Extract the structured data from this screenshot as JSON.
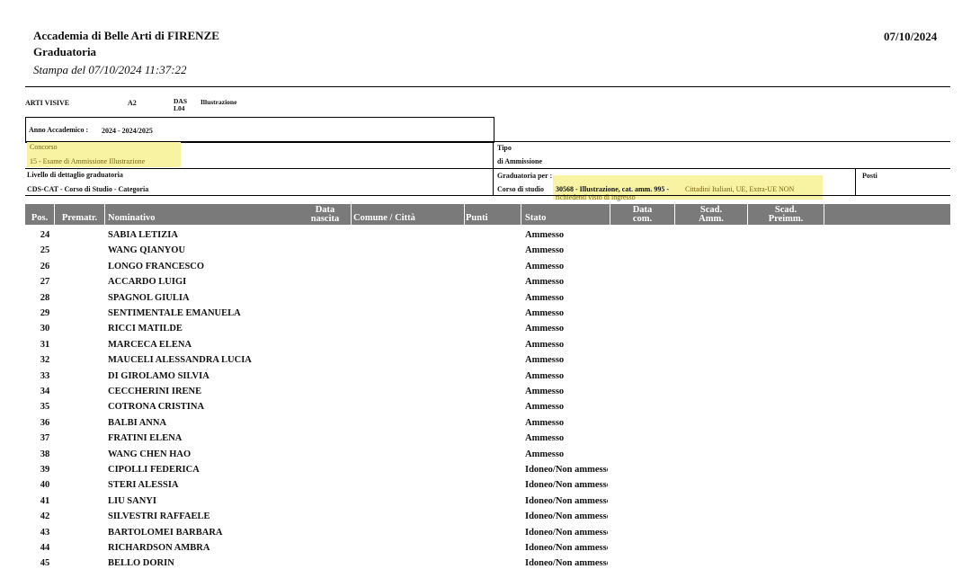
{
  "header": {
    "institution": "Accademia di Belle Arti di FIRENZE",
    "title": "Graduatoria",
    "printed": "Stampa del 07/10/2024 11:37:22",
    "date": "07/10/2024"
  },
  "course_line": {
    "area": "ARTI VISIVE",
    "level": "A2",
    "code_top": "DAS",
    "code_bottom": "L04",
    "name": "Illustrazione"
  },
  "info": {
    "anno_label": "Anno Accademico :",
    "anno_value": "2024  -  2024/2025",
    "concorso_label": "Concorso",
    "concorso_value": "15  -  Esame di Ammissione Illustrazione",
    "tipo_label": "Tipo",
    "tipo_value": "di Ammissione",
    "livello_label": "Livello di dettaglio graduatoria",
    "livello_value": "CDS-CAT  -  Corso di Studio - Categoria",
    "graduatoria_label": "Graduatoria per :",
    "corso_label": "Corso di studio",
    "corso_value": "30568 - Illustrazione, cat. amm. 995 -",
    "corso_category": "Cittadini Italiani, UE, Extra-UE NON",
    "corso_category2": "richiedenti visto di ingresso",
    "posti_label": "Posti"
  },
  "table": {
    "columns": {
      "pos": "Pos.",
      "premat": "Prematr.",
      "nominativo": "Nominativo",
      "data_nascita_1": "Data",
      "data_nascita_2": "nascita",
      "comune": "Comune / Città",
      "punti": "Punti",
      "stato": "Stato",
      "data_com_1": "Data",
      "data_com_2": "com.",
      "scad_amm_1": "Scad.",
      "scad_amm_2": "Amm.",
      "scad_preimm_1": "Scad.",
      "scad_preimm_2": "Preimm."
    },
    "rows": [
      {
        "pos": "24",
        "name": "SABIA  LETIZIA",
        "stato": "Ammesso"
      },
      {
        "pos": "25",
        "name": "WANG  QIANYOU",
        "stato": "Ammesso"
      },
      {
        "pos": "26",
        "name": "LONGO  FRANCESCO",
        "stato": "Ammesso"
      },
      {
        "pos": "27",
        "name": "ACCARDO  LUIGI",
        "stato": "Ammesso"
      },
      {
        "pos": "28",
        "name": "SPAGNOL  GIULIA",
        "stato": "Ammesso"
      },
      {
        "pos": "29",
        "name": "SENTIMENTALE  EMANUELA",
        "stato": "Ammesso"
      },
      {
        "pos": "30",
        "name": "RICCI  MATILDE",
        "stato": "Ammesso"
      },
      {
        "pos": "31",
        "name": "MARCECA  ELENA",
        "stato": "Ammesso"
      },
      {
        "pos": "32",
        "name": "MAUCELI  ALESSANDRA LUCIA",
        "stato": "Ammesso"
      },
      {
        "pos": "33",
        "name": "DI GIROLAMO  SILVIA",
        "stato": "Ammesso"
      },
      {
        "pos": "34",
        "name": "CECCHERINI  IRENE",
        "stato": "Ammesso"
      },
      {
        "pos": "35",
        "name": "COTRONA  CRISTINA",
        "stato": "Ammesso"
      },
      {
        "pos": "36",
        "name": "BALBI  ANNA",
        "stato": "Ammesso"
      },
      {
        "pos": "37",
        "name": "FRATINI  ELENA",
        "stato": "Ammesso"
      },
      {
        "pos": "38",
        "name": "WANG  CHEN HAO",
        "stato": "Ammesso"
      },
      {
        "pos": "39",
        "name": "CIPOLLI  FEDERICA",
        "stato": "Idoneo/Non ammesso"
      },
      {
        "pos": "40",
        "name": "STERI  ALESSIA",
        "stato": "Idoneo/Non ammesso"
      },
      {
        "pos": "41",
        "name": "LIU  SANYI",
        "stato": "Idoneo/Non ammesso"
      },
      {
        "pos": "42",
        "name": "SILVESTRI  RAFFAELE",
        "stato": "Idoneo/Non ammesso"
      },
      {
        "pos": "43",
        "name": "BARTOLOMEI  BARBARA",
        "stato": "Idoneo/Non ammesso"
      },
      {
        "pos": "44",
        "name": "RICHARDSON  AMBRA",
        "stato": "Idoneo/Non ammesso"
      },
      {
        "pos": "45",
        "name": "BELLO  DORIN",
        "stato": "Idoneo/Non ammesso"
      }
    ]
  }
}
